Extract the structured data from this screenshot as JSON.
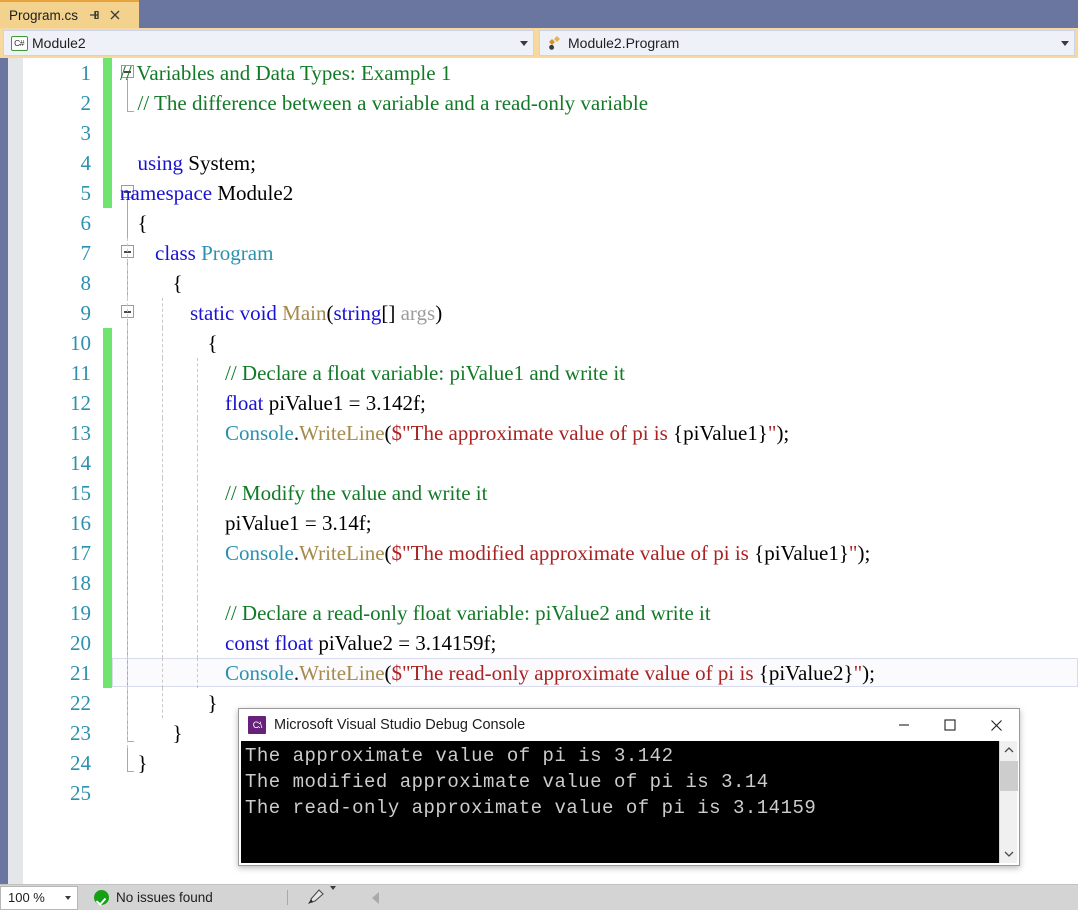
{
  "tab": {
    "label": "Program.cs",
    "pin_icon": "pin-icon",
    "close_icon": "close-icon"
  },
  "navbar": {
    "left": {
      "icon": "csharp-file-icon",
      "icon_label": "C#",
      "value": "Module2"
    },
    "right": {
      "icon": "method-icon",
      "value": "Module2.Program"
    }
  },
  "editor": {
    "lines": [
      {
        "n": "1",
        "changed": true,
        "collapse": "minus",
        "guides": 0,
        "indent": 0,
        "tokens": [
          {
            "t": "// Variables and Data Types: Example 1",
            "c": "c-com"
          }
        ]
      },
      {
        "n": "2",
        "changed": true,
        "collapse": "end",
        "guides": 0,
        "indent": 1,
        "tokens": [
          {
            "t": "// The difference between a variable and a read-only variable",
            "c": "c-com"
          }
        ]
      },
      {
        "n": "3",
        "changed": true,
        "collapse": "",
        "guides": 0,
        "indent": 0,
        "tokens": []
      },
      {
        "n": "4",
        "changed": true,
        "collapse": "",
        "guides": 0,
        "indent": 1,
        "tokens": [
          {
            "t": "using",
            "c": "c-kw"
          },
          {
            "t": " System;",
            "c": "c-plain"
          }
        ]
      },
      {
        "n": "5",
        "changed": true,
        "collapse": "minus",
        "guides": 0,
        "indent": 0,
        "tokens": [
          {
            "t": "namespace",
            "c": "c-kw"
          },
          {
            "t": " Module2",
            "c": "c-plain"
          }
        ]
      },
      {
        "n": "6",
        "changed": false,
        "collapse": "line",
        "guides": 0,
        "indent": 1,
        "tokens": [
          {
            "t": "{",
            "c": "c-plain"
          }
        ]
      },
      {
        "n": "7",
        "changed": false,
        "collapse": "minus2",
        "guides": 1,
        "indent": 2,
        "tokens": [
          {
            "t": "class",
            "c": "c-kw"
          },
          {
            "t": " ",
            "c": "c-plain"
          },
          {
            "t": "Program",
            "c": "c-type"
          }
        ]
      },
      {
        "n": "8",
        "changed": false,
        "collapse": "line",
        "guides": 1,
        "indent": 3,
        "tokens": [
          {
            "t": "{",
            "c": "c-plain"
          }
        ]
      },
      {
        "n": "9",
        "changed": false,
        "collapse": "minus3",
        "guides": 2,
        "indent": 4,
        "tokens": [
          {
            "t": "static void",
            "c": "c-kw"
          },
          {
            "t": " ",
            "c": "c-plain"
          },
          {
            "t": "Main",
            "c": "c-meth"
          },
          {
            "t": "(",
            "c": "c-plain"
          },
          {
            "t": "string",
            "c": "c-kw"
          },
          {
            "t": "[] ",
            "c": "c-plain"
          },
          {
            "t": "args",
            "c": "c-param"
          },
          {
            "t": ")",
            "c": "c-plain"
          }
        ]
      },
      {
        "n": "10",
        "changed": true,
        "collapse": "line",
        "guides": 2,
        "indent": 5,
        "tokens": [
          {
            "t": "{",
            "c": "c-plain"
          }
        ]
      },
      {
        "n": "11",
        "changed": true,
        "collapse": "line",
        "guides": 3,
        "indent": 6,
        "tokens": [
          {
            "t": "// Declare a float variable: piValue1 and write it",
            "c": "c-com"
          }
        ]
      },
      {
        "n": "12",
        "changed": true,
        "collapse": "line",
        "guides": 3,
        "indent": 6,
        "tokens": [
          {
            "t": "float",
            "c": "c-kw"
          },
          {
            "t": " piValue1 = 3.142f;",
            "c": "c-plain"
          }
        ]
      },
      {
        "n": "13",
        "changed": true,
        "collapse": "line",
        "guides": 3,
        "indent": 6,
        "tokens": [
          {
            "t": "Console",
            "c": "c-type"
          },
          {
            "t": ".",
            "c": "c-plain"
          },
          {
            "t": "WriteLine",
            "c": "c-meth"
          },
          {
            "t": "(",
            "c": "c-plain"
          },
          {
            "t": "$\"The approximate value of pi is ",
            "c": "c-str"
          },
          {
            "t": "{piValue1}",
            "c": "c-plain"
          },
          {
            "t": "\"",
            "c": "c-str"
          },
          {
            "t": ");",
            "c": "c-plain"
          }
        ]
      },
      {
        "n": "14",
        "changed": true,
        "collapse": "line",
        "guides": 3,
        "indent": 0,
        "tokens": []
      },
      {
        "n": "15",
        "changed": true,
        "collapse": "line",
        "guides": 3,
        "indent": 6,
        "tokens": [
          {
            "t": "// Modify the value and write it",
            "c": "c-com"
          }
        ]
      },
      {
        "n": "16",
        "changed": true,
        "collapse": "line",
        "guides": 3,
        "indent": 6,
        "tokens": [
          {
            "t": "piValue1 = 3.14f;",
            "c": "c-plain"
          }
        ]
      },
      {
        "n": "17",
        "changed": true,
        "collapse": "line",
        "guides": 3,
        "indent": 6,
        "tokens": [
          {
            "t": "Console",
            "c": "c-type"
          },
          {
            "t": ".",
            "c": "c-plain"
          },
          {
            "t": "WriteLine",
            "c": "c-meth"
          },
          {
            "t": "(",
            "c": "c-plain"
          },
          {
            "t": "$\"The modified approximate value of pi is ",
            "c": "c-str"
          },
          {
            "t": "{piValue1}",
            "c": "c-plain"
          },
          {
            "t": "\"",
            "c": "c-str"
          },
          {
            "t": ");",
            "c": "c-plain"
          }
        ]
      },
      {
        "n": "18",
        "changed": true,
        "collapse": "line",
        "guides": 3,
        "indent": 0,
        "tokens": []
      },
      {
        "n": "19",
        "changed": true,
        "collapse": "line",
        "guides": 3,
        "indent": 6,
        "tokens": [
          {
            "t": "// Declare a read-only float variable: piValue2 and write it",
            "c": "c-com"
          }
        ]
      },
      {
        "n": "20",
        "changed": true,
        "collapse": "line",
        "guides": 3,
        "indent": 6,
        "tokens": [
          {
            "t": "const float",
            "c": "c-kw"
          },
          {
            "t": " piValue2 = 3.14159f;",
            "c": "c-plain"
          }
        ]
      },
      {
        "n": "21",
        "changed": true,
        "collapse": "line",
        "guides": 3,
        "indent": 6,
        "current": true,
        "tokens": [
          {
            "t": "Console",
            "c": "c-type"
          },
          {
            "t": ".",
            "c": "c-plain"
          },
          {
            "t": "WriteLine",
            "c": "c-meth"
          },
          {
            "t": "(",
            "c": "c-plain"
          },
          {
            "t": "$\"The read-only approximate value of pi is ",
            "c": "c-str"
          },
          {
            "t": "{piValue2}",
            "c": "c-plain"
          },
          {
            "t": "\"",
            "c": "c-str"
          },
          {
            "t": ");",
            "c": "c-plain"
          }
        ]
      },
      {
        "n": "22",
        "changed": false,
        "collapse": "line",
        "guides": 2,
        "indent": 5,
        "tokens": [
          {
            "t": "}",
            "c": "c-plain"
          }
        ]
      },
      {
        "n": "23",
        "changed": false,
        "collapse": "end3",
        "guides": 1,
        "indent": 3,
        "tokens": [
          {
            "t": "}",
            "c": "c-plain"
          }
        ]
      },
      {
        "n": "24",
        "changed": false,
        "collapse": "end1",
        "guides": 0,
        "indent": 1,
        "tokens": [
          {
            "t": "}",
            "c": "c-plain"
          }
        ]
      },
      {
        "n": "25",
        "changed": false,
        "collapse": "",
        "guides": 0,
        "indent": 0,
        "tokens": []
      }
    ]
  },
  "console_window": {
    "title": "Microsoft Visual Studio Debug Console",
    "app_icon_label": "C:\\",
    "minimize_label": "—",
    "maximize_label": "☐",
    "close_label": "✕",
    "output": "The approximate value of pi is 3.142\nThe modified approximate value of pi is 3.14\nThe read-only approximate value of pi is 3.14159"
  },
  "statusbar": {
    "zoom": "100 %",
    "issues": "No issues found",
    "issues_icon": "check-circle-icon",
    "brush_icon": "brush-icon",
    "back_icon": "left-arrow-icon"
  },
  "colors": {
    "accent_tab": "#f2d28c",
    "accent_tab_border": "#e8a33d",
    "navbar_bg": "#f7d9a0",
    "chrome_blue": "#6a76a0",
    "change_bar": "#6fe56f",
    "comment": "#127a27",
    "keyword": "#1a12d2",
    "type": "#2b91af",
    "method": "#a58a4c",
    "string": "#aa2222",
    "parameter": "#9c9c9c",
    "linenumber": "#2b91af",
    "status_ok": "#16a016"
  }
}
